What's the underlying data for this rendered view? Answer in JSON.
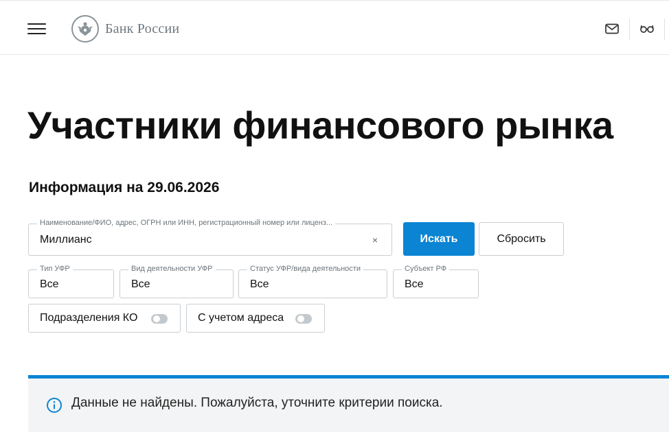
{
  "header": {
    "brand": "Банк России",
    "icons": [
      "menu-icon",
      "bank-emblem-icon",
      "mail-icon",
      "glasses-icon"
    ]
  },
  "page": {
    "title": "Участники финансового рынка",
    "info_date": "Информация на 29.06.2026"
  },
  "search": {
    "label": "Наименование/ФИО, адрес, ОГРН или ИНН, регистрационный номер или лиценз...",
    "value": "Миллианс",
    "clear_symbol": "×",
    "search_button": "Искать",
    "reset_button": "Сбросить"
  },
  "filters": [
    {
      "label": "Тип УФР",
      "value": "Все"
    },
    {
      "label": "Вид деятельности УФР",
      "value": "Все"
    },
    {
      "label": "Статус УФР/вида деятельности",
      "value": "Все"
    },
    {
      "label": "Субъект РФ",
      "value": "Все"
    }
  ],
  "toggles": [
    {
      "label": "Подразделения КО",
      "on": false
    },
    {
      "label": "С учетом адреса",
      "on": false
    }
  ],
  "result": {
    "message": "Данные не найдены. Пожалуйста, уточните критерии поиска."
  },
  "colors": {
    "accent": "#0b84d3",
    "notice_bg": "#f2f4f5",
    "border": "#c9ced2"
  }
}
